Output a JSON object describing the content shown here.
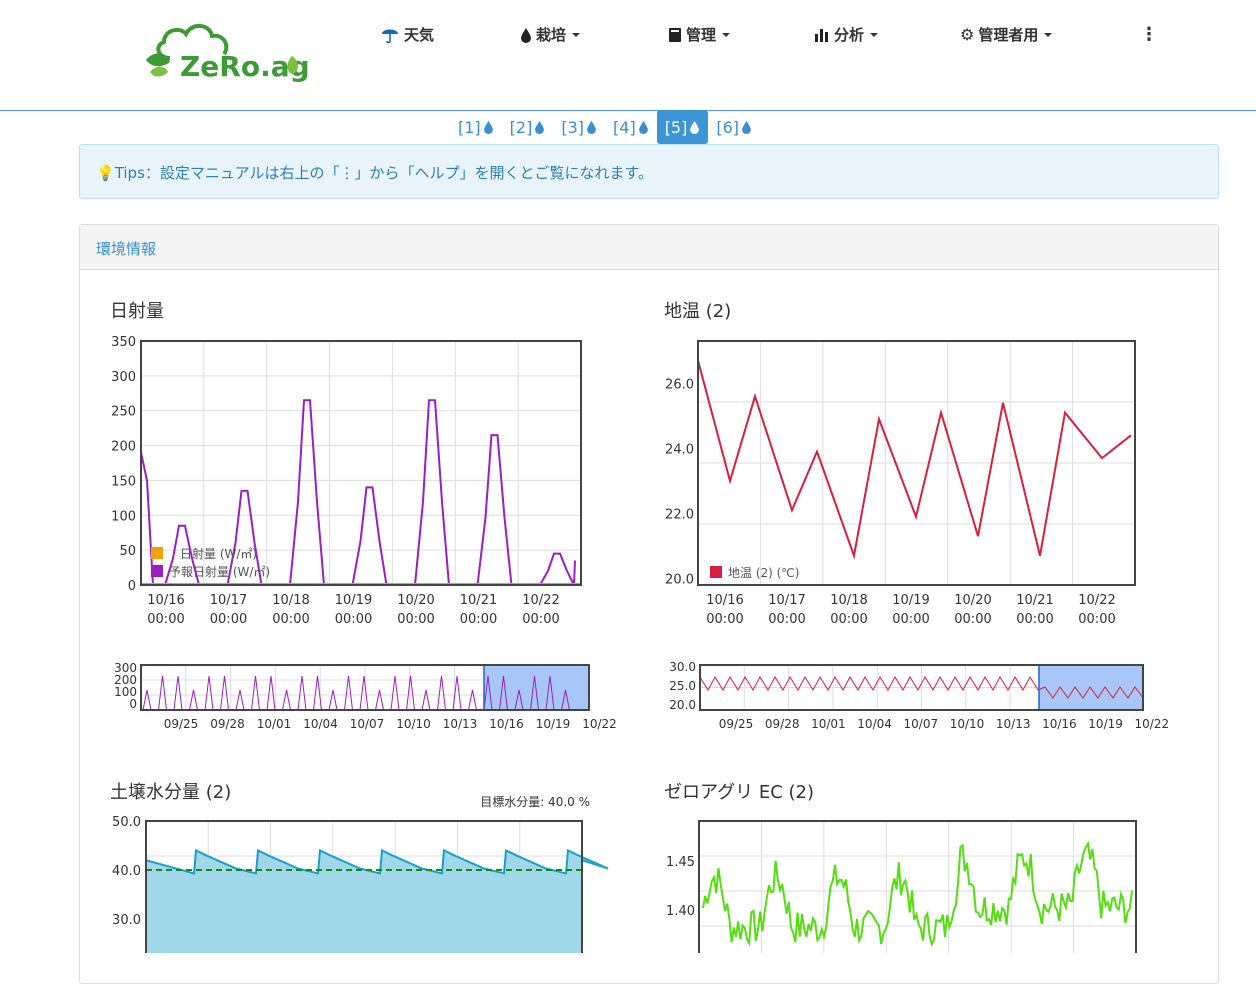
{
  "brand": {
    "logo_text": "ZeRo.agri"
  },
  "nav": {
    "weather": "天気",
    "cultivation": "栽培",
    "management": "管理",
    "analysis": "分析",
    "admin": "管理者用",
    "more": "⋮"
  },
  "pager": {
    "pages": [
      "[1]",
      "[2]",
      "[3]",
      "[4]",
      "[5]",
      "[6]"
    ],
    "active_index": 4
  },
  "tips": {
    "text": "Tips：設定マニュアルは右上の「⋮」から「ヘルプ」を開くとご覧になれます。"
  },
  "panel": {
    "title": "環境情報"
  },
  "colors": {
    "accent": "#3b95d6",
    "solar": "#f59f00",
    "forecast": "#9b1fbf",
    "soil_temp": "#d6203c",
    "moisture": "#1aa0c8",
    "ec": "#55dd11",
    "target": "#138a13"
  },
  "chart_data": [
    {
      "type": "line",
      "title": "日射量",
      "ylim": [
        0,
        350
      ],
      "y_ticks": [
        "0",
        "50",
        "100",
        "150",
        "200",
        "250",
        "300",
        "350"
      ],
      "x_ticks": [
        [
          "10/16",
          "00:00"
        ],
        [
          "10/17",
          "00:00"
        ],
        [
          "10/18",
          "00:00"
        ],
        [
          "10/19",
          "00:00"
        ],
        [
          "10/20",
          "00:00"
        ],
        [
          "10/21",
          "00:00"
        ],
        [
          "10/22",
          "00:00"
        ]
      ],
      "legend_placement": "bottom-left",
      "series": [
        {
          "name": "日射量 (W/㎡)",
          "values": [
            0,
            0,
            0,
            0,
            0,
            0,
            0
          ]
        },
        {
          "name": "予報日射量 (W/㎡)",
          "daily_peaks": [
            85,
            135,
            265,
            140,
            265,
            215,
            45
          ]
        }
      ],
      "overview": {
        "y_ticks": [
          "0",
          "100",
          "200",
          "300"
        ],
        "x_ticks": [
          "09/25",
          "09/28",
          "10/01",
          "10/04",
          "10/07",
          "10/10",
          "10/13",
          "10/16",
          "10/19",
          "10/22"
        ]
      }
    },
    {
      "type": "line",
      "title": "地温 (2)",
      "ylim": [
        19.8,
        27.3
      ],
      "y_ticks": [
        "20.0",
        "22.0",
        "24.0",
        "26.0"
      ],
      "x_ticks": [
        [
          "10/16",
          "00:00"
        ],
        [
          "10/17",
          "00:00"
        ],
        [
          "10/18",
          "00:00"
        ],
        [
          "10/19",
          "00:00"
        ],
        [
          "10/20",
          "00:00"
        ],
        [
          "10/21",
          "00:00"
        ],
        [
          "10/22",
          "00:00"
        ]
      ],
      "legend_placement": "bottom-left",
      "series": [
        {
          "name": "地温 (2) (℃)",
          "daily_max": [
            26.7,
            25.6,
            23.9,
            24.9,
            25.1,
            25.4,
            25.1
          ],
          "daily_min": [
            23.0,
            22.1,
            20.7,
            21.9,
            21.3,
            20.7,
            23.7
          ]
        }
      ],
      "overview": {
        "y_ticks": [
          "20.0",
          "25.0",
          "30.0"
        ],
        "x_ticks": [
          "09/25",
          "09/28",
          "10/01",
          "10/04",
          "10/07",
          "10/10",
          "10/13",
          "10/16",
          "10/19",
          "10/22"
        ]
      }
    },
    {
      "type": "area",
      "title": "土壌水分量 (2)",
      "annotation": "目標水分量: 40.0 %",
      "target": 40.0,
      "y_ticks": [
        "30.0",
        "40.0",
        "50.0"
      ],
      "daily_peaks": [
        44,
        44,
        44,
        44,
        44,
        44,
        44
      ]
    },
    {
      "type": "line",
      "title": "ゼロアグリ EC (2)",
      "y_ticks": [
        "1.40",
        "1.45"
      ]
    }
  ]
}
